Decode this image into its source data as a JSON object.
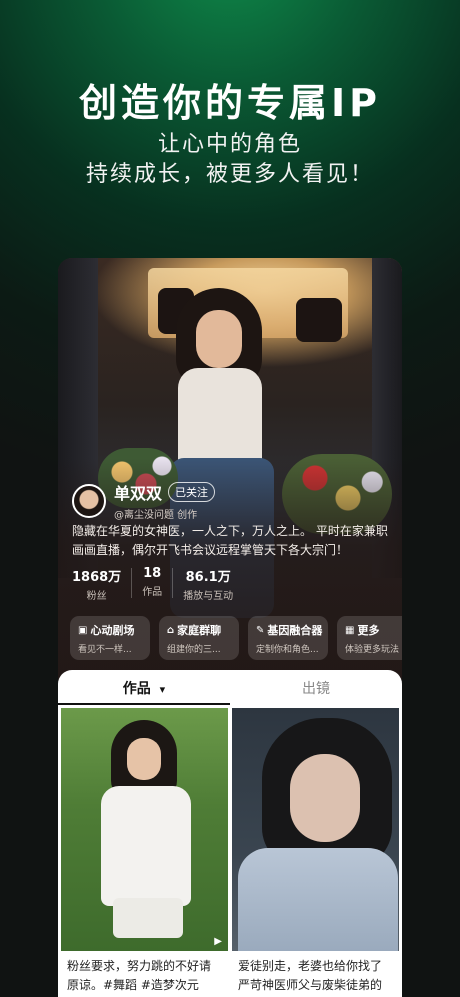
{
  "headline": "创造你的专属IP",
  "sub_line1": "让心中的角色",
  "sub_line2": "持续成长，被更多人看见！",
  "profile": {
    "name": "单双双",
    "follow_status": "已关注",
    "creator": "@离尘没问题 创作",
    "bio": "隐藏在华夏的女神医，一人之下，万人之上。 平时在家兼职画画直播，偶尔开飞书会议远程掌管天下各大宗门！"
  },
  "stats": [
    {
      "value": "1868万",
      "label": "粉丝"
    },
    {
      "value": "18",
      "label": "作品"
    },
    {
      "value": "86.1万",
      "label": "播放与互动"
    }
  ],
  "features": [
    {
      "icon": "theater-icon",
      "title": "心动剧场",
      "desc": "看见不一样..."
    },
    {
      "icon": "home-icon",
      "title": "家庭群聊",
      "desc": "组建你的三..."
    },
    {
      "icon": "dna-icon",
      "title": "基因融合器",
      "desc": "定制你和角色..."
    },
    {
      "icon": "grid-icon",
      "title": "更多",
      "desc": "体验更多玩法"
    }
  ],
  "tabs": {
    "works": "作品",
    "works_arrow": "▾",
    "cameo": "出镜"
  },
  "posts": [
    {
      "caption": "粉丝要求，努力跳的不好请原谅。#舞蹈 #造梦次元",
      "play": "▶"
    },
    {
      "caption": "爱徒别走，老婆也给你找了 严苛神医师父与废柴徒弟的日常，师可美华事灾好的",
      "play": ""
    }
  ]
}
